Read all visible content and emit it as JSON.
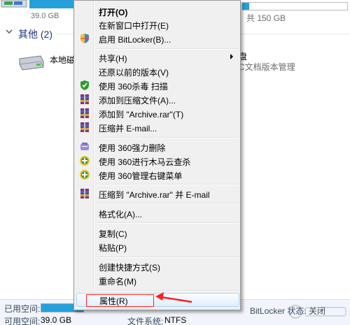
{
  "explorer": {
    "top_drive_size": "39.0 GB",
    "top_drive_free": "，共 150 GB",
    "group_title": "其他 (2)",
    "local_drive_name": "本地磁",
    "dvd_name": "盘",
    "dvd_sub": "C文档版本管理",
    "details": {
      "used_label": "已用空间:",
      "used_fraction": 0.25,
      "free_label": "可用空间:",
      "free_value": "39.0 GB",
      "total_text": "",
      "fs_label": "文件系统:",
      "fs_value": "NTFS",
      "bitlocker": "BitLocker 状态: 关闭"
    }
  },
  "menu": {
    "items": [
      {
        "label": "打开(O)",
        "icon": "none",
        "bold": true
      },
      {
        "label": "在新窗口中打开(E)",
        "icon": "none"
      },
      {
        "label": "启用 BitLocker(B)...",
        "icon": "shield-icon"
      },
      {
        "label": "共享(H)",
        "icon": "none",
        "submenu": true
      },
      {
        "label": "还原以前的版本(V)",
        "icon": "none"
      },
      {
        "label": "使用 360杀毒 扫描",
        "icon": "360-antivirus-icon"
      },
      {
        "label": "添加到压缩文件(A)...",
        "icon": "winrar-icon"
      },
      {
        "label": "添加到 \"Archive.rar\"(T)",
        "icon": "winrar-icon"
      },
      {
        "label": "压缩并 E-mail...",
        "icon": "winrar-icon"
      },
      {
        "label": "使用 360强力删除",
        "icon": "360-delete-icon"
      },
      {
        "label": "使用 360进行木马云查杀",
        "icon": "360-plus-icon"
      },
      {
        "label": "使用 360管理右键菜单",
        "icon": "360-plus-icon"
      },
      {
        "label": "压缩到 \"Archive.rar\" 并 E-mail",
        "icon": "winrar-icon"
      },
      {
        "label": "格式化(A)...",
        "icon": "none"
      },
      {
        "label": "复制(C)",
        "icon": "none"
      },
      {
        "label": "粘贴(P)",
        "icon": "none"
      },
      {
        "label": "创建快捷方式(S)",
        "icon": "none"
      },
      {
        "label": "重命名(M)",
        "icon": "none"
      },
      {
        "label": "属性(R)",
        "icon": "none",
        "highlighted": true
      }
    ]
  },
  "annotation": {
    "highlight_color": "#ff2020"
  },
  "colors": {
    "menu_bg": "#f0f0f0",
    "menu_border": "#979797",
    "drive_bar": "#26a0da",
    "group_title": "#1e3287"
  }
}
